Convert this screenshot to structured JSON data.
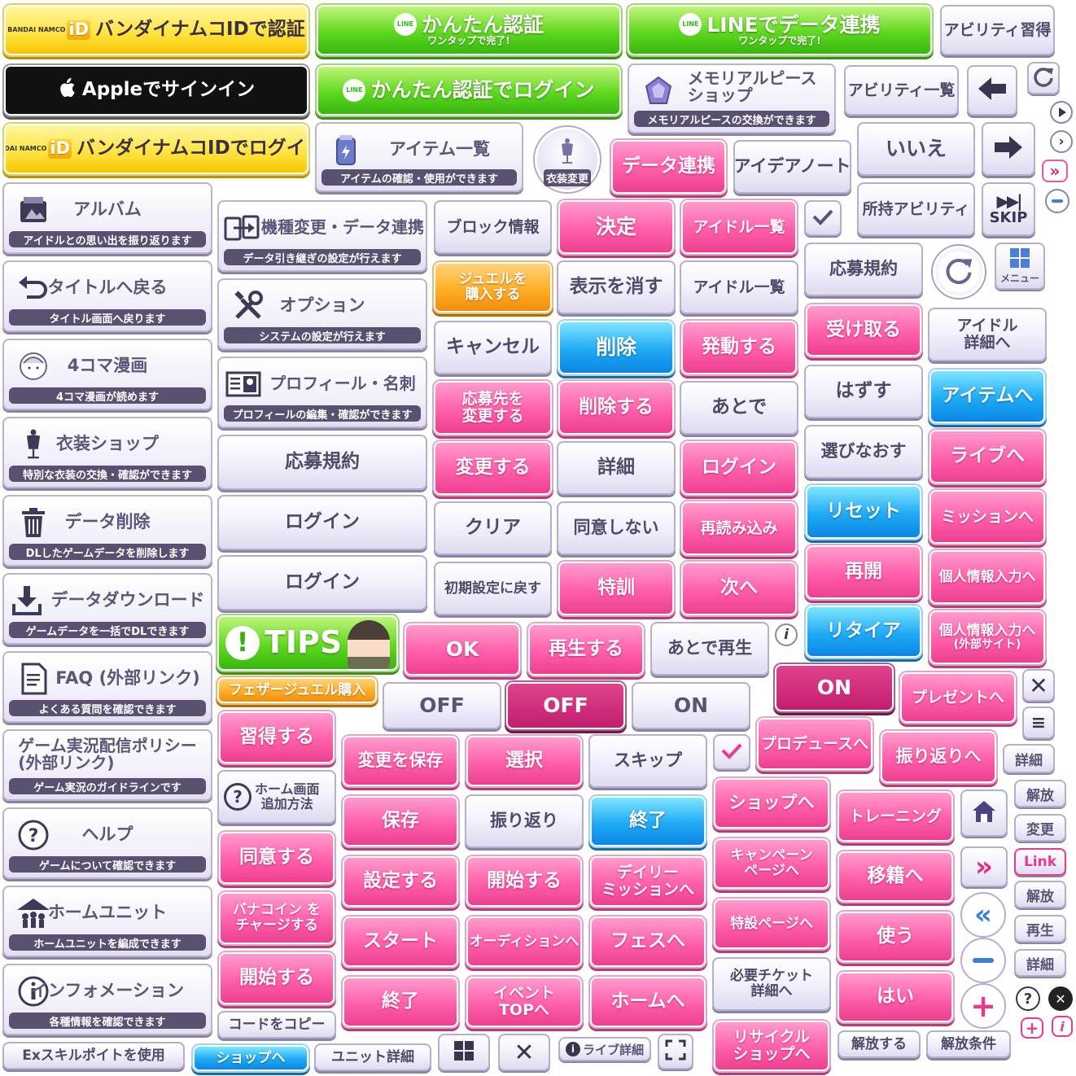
{
  "row1": {
    "bn_auth": "バンダイナムコIDで認証",
    "bn_logo": "BANDAI NAMCO",
    "bn_id": "iD",
    "line_easy": "かんたん認証",
    "line_easy_sub": "ワンタップで完了!",
    "line_data": "LINEでデータ連携",
    "line_data_sub": "ワンタップで完了!",
    "line_badge": "LINE",
    "ability_learn": "アビリティ習得"
  },
  "row2": {
    "apple": "Appleでサインイン",
    "line_login": "かんたん認証でログイン",
    "memorial": "メモリアルピース\nショップ",
    "memorial_sub": "メモリアルピースの交換ができます",
    "ability_list": "アビリティ一覧"
  },
  "row3": {
    "bn_login": "バンダイナムコIDでログイン",
    "item_list": "アイテム一覧",
    "item_list_sub": "アイテムの確認・使用ができます",
    "costume": "衣装変更",
    "data_link": "データ連携",
    "idea_note": "アイデアノート",
    "no": "いいえ"
  },
  "row4": {
    "owned_ability": "所持アビリティ",
    "skip": "SKIP"
  },
  "cards": [
    {
      "title": "アルバム",
      "sub": "アイドルとの思い出を振り返ります",
      "icon": "album-icon"
    },
    {
      "title": "タイトルへ戻る",
      "sub": "タイトル画面へ戻ります",
      "icon": "return-icon"
    },
    {
      "title": "4コマ漫画",
      "sub": "4コマ漫画が読めます",
      "icon": "manga-icon"
    },
    {
      "title": "衣装ショップ",
      "sub": "特別な衣装の交換・確認ができます",
      "icon": "mannequin-icon"
    },
    {
      "title": "データ削除",
      "sub": "DLしたゲームデータを削除します",
      "icon": "trash-icon"
    },
    {
      "title": "データダウンロード",
      "sub": "ゲームデータを一括でDLできます",
      "icon": "download-icon"
    },
    {
      "title": "FAQ (外部リンク)",
      "sub": "よくある質問を確認できます",
      "icon": "document-icon"
    },
    {
      "title": "ゲーム実況配信ポリシー\n(外部リンク)",
      "sub": "ゲーム実況のガイドラインです",
      "icon": ""
    },
    {
      "title": "ヘルプ",
      "sub": "ゲームについて確認できます",
      "icon": "help-icon"
    },
    {
      "title": "ホームユニット",
      "sub": "ホームユニットを編成できます",
      "icon": "home-unit-icon"
    },
    {
      "title": "インフォメーション",
      "sub": "各種情報を確認できます",
      "icon": "info-icon"
    }
  ],
  "cards2": [
    {
      "title": "機種変更・データ連携",
      "sub": "データ引き継ぎの設定が行えます",
      "icon": "device-transfer-icon"
    },
    {
      "title": "オプション",
      "sub": "システムの設定が行えます",
      "icon": "tools-icon"
    },
    {
      "title": "プロフィール・名刺",
      "sub": "プロフィールの編集・確認ができます",
      "icon": "profile-card-icon"
    }
  ],
  "col2": {
    "apply_rules": "応募規約",
    "login1": "ログイン",
    "login2": "ログイン",
    "tips": "TIPS",
    "feather": "フェザージュエル購入",
    "learn": "習得する",
    "home_add": "ホーム画面\n追加方法",
    "agree": "同意する",
    "banacoin": "バナコイン を\nチャージする",
    "start": "開始する",
    "copy_code": "コードをコピー"
  },
  "col3": {
    "block": "ブロック情報",
    "jewel": "ジュエルを\n購入する",
    "cancel": "キャンセル",
    "change_dest": "応募先を\n変更する",
    "change": "変更する",
    "clear": "クリア",
    "reset_init": "初期設定に戻す"
  },
  "col4": {
    "decide": "決定",
    "hide": "表示を消す",
    "delete": "削除",
    "delete_do": "削除する",
    "detail": "詳細",
    "disagree": "同意しない",
    "training": "特訓"
  },
  "col5": {
    "idol_list": "アイドル一覧",
    "idol_list2": "アイドル一覧",
    "activate": "発動する",
    "later": "あとで",
    "login": "ログイン",
    "reload": "再読み込み",
    "next": "次へ"
  },
  "col6": {
    "apply_rules": "応募規約",
    "receive": "受け取る",
    "remove": "はずす",
    "reselect": "選びなおす",
    "reset": "リセット",
    "resume": "再開",
    "retire": "リタイア",
    "menu": "メニュー"
  },
  "col7": {
    "idol_detail": "アイドル\n詳細へ",
    "item_go": "アイテムへ",
    "live_go": "ライブへ",
    "mission_go": "ミッションへ",
    "personal": "個人情報入力へ",
    "personal_ext": "個人情報入力へ",
    "personal_ext_sub": "(外部サイト)"
  },
  "row_ok": {
    "ok": "OK",
    "play": "再生する",
    "play_later": "あとで再生"
  },
  "toggle": {
    "off1": "OFF",
    "off2": "OFF",
    "on1": "ON",
    "on2": "ON"
  },
  "present": "プレゼントへ",
  "grid": {
    "save_change": "変更を保存",
    "select": "選択",
    "skip": "スキップ",
    "produce": "プロデュースへ",
    "look_back": "振り返りへ",
    "detail_sm": "詳細",
    "save": "保存",
    "look_back2": "振り返り",
    "end": "終了",
    "shop": "ショップへ",
    "lesson": "トレーニング",
    "set": "設定する",
    "begin": "開始する",
    "daily": "デイリー\nミッションへ",
    "campaign": "キャンペーン\nページへ",
    "transfer": "移籍へ",
    "start": "スタート",
    "audition": "オーディションへ",
    "fes": "フェスへ",
    "special": "特設ページへ",
    "use": "使う",
    "end2": "終了",
    "event_top": "イベント\nTOPへ",
    "home": "ホームへ",
    "ticket": "必要チケット\n詳細へ",
    "yes": "はい",
    "recycle": "リサイクル\nショップへ",
    "unlock_do": "解放する",
    "unlock_cond": "解放条件"
  },
  "small_right": {
    "unlock1": "解放",
    "change": "変更",
    "link": "Link",
    "unlock2": "解放",
    "replay": "再生",
    "detail": "詳細"
  },
  "bottom": {
    "ex_skill": "Exスキルポイトを使用",
    "shop": "ショップへ",
    "unit_detail": "ユニット詳細",
    "live_detail": "ライブ詳細"
  }
}
